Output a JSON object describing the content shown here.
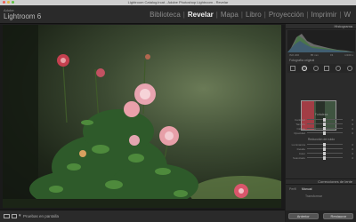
{
  "window": {
    "title": "Lightroom Catalog.lrcat - Adobe Photoshop Lightroom - Revelar"
  },
  "brand": {
    "vendor": "Adobe",
    "product": "Lightroom 6"
  },
  "modules": [
    {
      "label": "Biblioteca",
      "active": false
    },
    {
      "label": "Revelar",
      "active": true
    },
    {
      "label": "Mapa",
      "active": false
    },
    {
      "label": "Libro",
      "active": false
    },
    {
      "label": "Proyección",
      "active": false
    },
    {
      "label": "Imprimir",
      "active": false
    },
    {
      "label": "W",
      "active": false
    }
  ],
  "right_panel": {
    "histogram_title": "Histograma",
    "histogram_info": [
      "ISO 200",
      "85 mm",
      "f/4",
      "1/160 s"
    ],
    "original_photo_label": "Fotografía original",
    "tools": [
      "crop-icon",
      "spot-removal-icon",
      "red-eye-icon",
      "graduated-filter-icon",
      "radial-filter-icon",
      "adjustment-brush-icon"
    ],
    "group1_title": "Fortaleza",
    "group1_sliders": [
      {
        "label": "Cantidad",
        "value": "0"
      },
      {
        "label": "Tamaño",
        "value": "0"
      },
      {
        "label": "Calado",
        "value": "0"
      },
      {
        "label": "Opacidad",
        "value": "0"
      }
    ],
    "group2_title": "Reducción de ruido",
    "group2_sliders": [
      {
        "label": "Luminancia",
        "value": "0"
      },
      {
        "label": "Detalle",
        "value": "0"
      },
      {
        "label": "Color",
        "value": "0"
      },
      {
        "label": "Suavizado",
        "value": "0"
      }
    ],
    "lens_section": "Correcciones de lente",
    "lens_tabs": [
      {
        "label": "Perfil",
        "active": false
      },
      {
        "label": "Manual",
        "active": true
      }
    ],
    "lens_sub": "Transformar"
  },
  "buttons": {
    "previous": "Anterior",
    "reset": "Restaurar"
  },
  "toolbar": {
    "mode_label": "Pruebas en pantalla"
  }
}
